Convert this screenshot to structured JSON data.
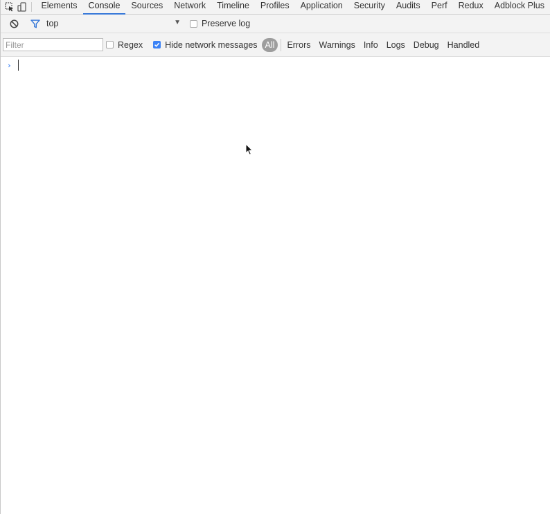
{
  "tabbar": {
    "tabs": [
      {
        "label": "Elements",
        "active": false
      },
      {
        "label": "Console",
        "active": true
      },
      {
        "label": "Sources",
        "active": false
      },
      {
        "label": "Network",
        "active": false
      },
      {
        "label": "Timeline",
        "active": false
      },
      {
        "label": "Profiles",
        "active": false
      },
      {
        "label": "Application",
        "active": false
      },
      {
        "label": "Security",
        "active": false
      },
      {
        "label": "Audits",
        "active": false
      },
      {
        "label": "Perf",
        "active": false
      },
      {
        "label": "Redux",
        "active": false
      },
      {
        "label": "Adblock Plus",
        "active": false
      }
    ],
    "icons": [
      "inspect-element-icon",
      "device-toolbar-icon"
    ]
  },
  "contextbar": {
    "context_value": "top",
    "preserve_log_label": "Preserve log",
    "preserve_log_checked": false,
    "icons": [
      "clear-console-icon",
      "filter-icon"
    ]
  },
  "filterbar": {
    "filter_placeholder": "Filter",
    "filter_value": "",
    "regex_label": "Regex",
    "regex_checked": false,
    "hide_network_label": "Hide network messages",
    "hide_network_checked": true,
    "levels": {
      "all": "All",
      "errors": "Errors",
      "warnings": "Warnings",
      "info": "Info",
      "logs": "Logs",
      "debug": "Debug",
      "handled": "Handled"
    }
  },
  "console": {
    "prompt_value": ""
  },
  "colors": {
    "accent": "#3879d9",
    "toolbar_bg": "#f3f3f3",
    "checkbox_checked": "#3b82f6",
    "all_pill": "#9d9d9d"
  }
}
